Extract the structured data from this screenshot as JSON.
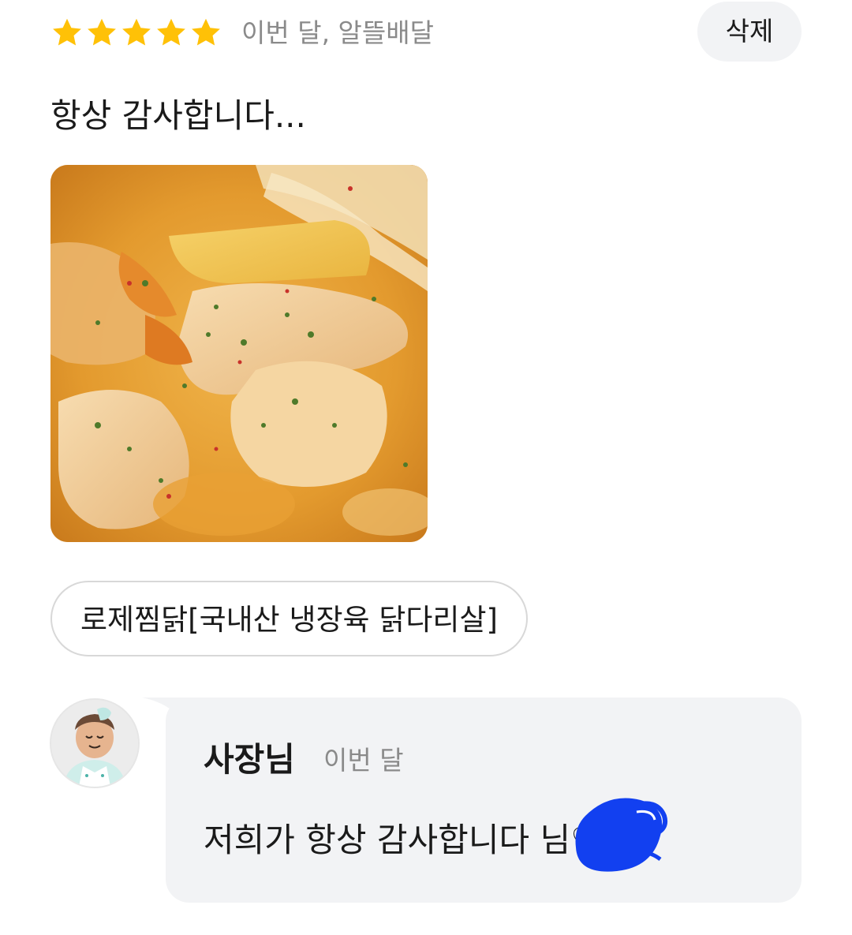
{
  "review": {
    "rating": 5,
    "rating_max": 5,
    "meta": "이번 달, 알뜰배달",
    "delete_label": "삭제",
    "text": "항상 감사합니다...",
    "menu_item": "로제찜닭[국내산 냉장육 닭다리살]"
  },
  "reply": {
    "author": "사장님",
    "date": "이번 달",
    "text": "저희가 항상 감사합니다 님♡"
  },
  "colors": {
    "star": "#FFC107",
    "meta_gray": "#8A8A8A",
    "bubble_bg": "#F2F3F5",
    "redaction": "#1240F0"
  },
  "icons": [
    "star-icon",
    "owner-avatar-icon",
    "redaction-scribble"
  ]
}
